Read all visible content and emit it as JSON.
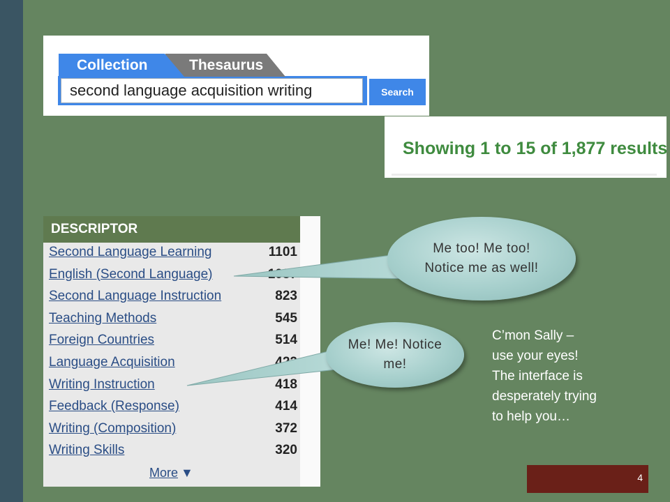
{
  "search": {
    "tabs": [
      "Collection",
      "Thesaurus"
    ],
    "query": "second language acquisition writing",
    "button_label": "Search"
  },
  "results": {
    "text": "Showing 1 to 15 of 1,877 results"
  },
  "descriptor": {
    "header": "DESCRIPTOR",
    "items": [
      {
        "label": "Second Language Learning",
        "count": "1101"
      },
      {
        "label": "English (Second Language)",
        "count": "1037"
      },
      {
        "label": "Second Language Instruction",
        "count": "823"
      },
      {
        "label": "Teaching Methods",
        "count": "545"
      },
      {
        "label": "Foreign Countries",
        "count": "514"
      },
      {
        "label": "Language Acquisition",
        "count": "422"
      },
      {
        "label": "Writing Instruction",
        "count": "418"
      },
      {
        "label": "Feedback (Response)",
        "count": "414"
      },
      {
        "label": "Writing (Composition)",
        "count": "372"
      },
      {
        "label": "Writing Skills",
        "count": "320"
      }
    ],
    "more_label": "More",
    "more_icon": "triangle-down-icon"
  },
  "callouts": {
    "first": "Me too! Me too! Notice me as well!",
    "second": "Me! Me! Notice me!"
  },
  "caption": {
    "lines": [
      "C’mon Sally –",
      "use your eyes!",
      "The interface is",
      "desperately trying",
      "to help you…"
    ]
  },
  "page_number": "4",
  "colors": {
    "background": "#658560",
    "left_bar": "#3a5563",
    "tab_active": "#3f87e8",
    "tab_inactive": "#7a7a7a",
    "results_text": "#3f8b3f",
    "descriptor_header": "#5f7a4f",
    "page_box": "#6a2018"
  }
}
